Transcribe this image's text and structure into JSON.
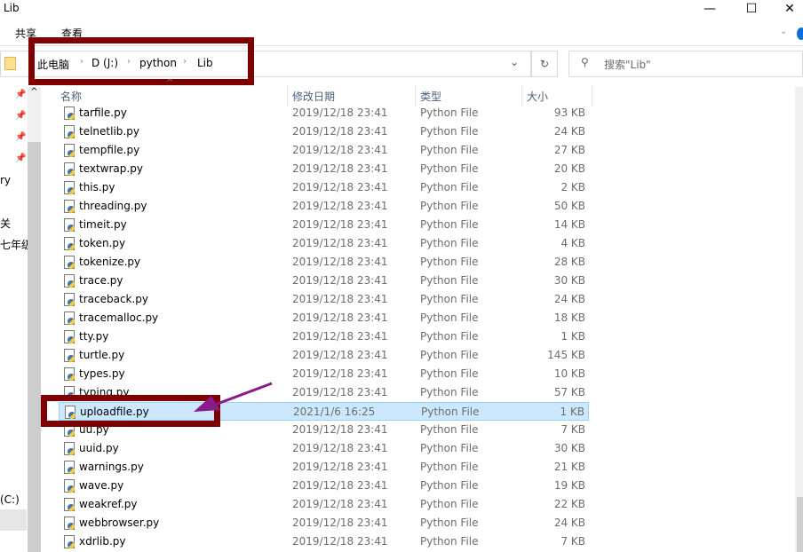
{
  "window": {
    "title": "Lib",
    "minimize": "—",
    "maximize": "☐",
    "close": "✕"
  },
  "ribbon": {
    "tabs": [
      "共享",
      "查看"
    ]
  },
  "address": {
    "crumbs": [
      "此电脑",
      "D (J:)",
      "python",
      "Lib"
    ],
    "separator": "›",
    "dropdown": "⌄",
    "refresh": "↻"
  },
  "search": {
    "placeholder": "搜索\"Lib\"",
    "icon": "search-icon"
  },
  "nav": {
    "items": [
      "ry",
      "关",
      "七年级",
      "(C:)"
    ],
    "pin": "📌"
  },
  "columns": {
    "name": "名称",
    "date": "修改日期",
    "type": "类型",
    "size": "大小"
  },
  "files": [
    {
      "name": "tarfile.py",
      "date": "2019/12/18 23:41",
      "type": "Python File",
      "size": "93 KB"
    },
    {
      "name": "telnetlib.py",
      "date": "2019/12/18 23:41",
      "type": "Python File",
      "size": "24 KB"
    },
    {
      "name": "tempfile.py",
      "date": "2019/12/18 23:41",
      "type": "Python File",
      "size": "27 KB"
    },
    {
      "name": "textwrap.py",
      "date": "2019/12/18 23:41",
      "type": "Python File",
      "size": "20 KB"
    },
    {
      "name": "this.py",
      "date": "2019/12/18 23:41",
      "type": "Python File",
      "size": "2 KB"
    },
    {
      "name": "threading.py",
      "date": "2019/12/18 23:41",
      "type": "Python File",
      "size": "50 KB"
    },
    {
      "name": "timeit.py",
      "date": "2019/12/18 23:41",
      "type": "Python File",
      "size": "14 KB"
    },
    {
      "name": "token.py",
      "date": "2019/12/18 23:41",
      "type": "Python File",
      "size": "4 KB"
    },
    {
      "name": "tokenize.py",
      "date": "2019/12/18 23:41",
      "type": "Python File",
      "size": "28 KB"
    },
    {
      "name": "trace.py",
      "date": "2019/12/18 23:41",
      "type": "Python File",
      "size": "30 KB"
    },
    {
      "name": "traceback.py",
      "date": "2019/12/18 23:41",
      "type": "Python File",
      "size": "24 KB"
    },
    {
      "name": "tracemalloc.py",
      "date": "2019/12/18 23:41",
      "type": "Python File",
      "size": "18 KB"
    },
    {
      "name": "tty.py",
      "date": "2019/12/18 23:41",
      "type": "Python File",
      "size": "1 KB"
    },
    {
      "name": "turtle.py",
      "date": "2019/12/18 23:41",
      "type": "Python File",
      "size": "145 KB"
    },
    {
      "name": "types.py",
      "date": "2019/12/18 23:41",
      "type": "Python File",
      "size": "10 KB"
    },
    {
      "name": "typing.py",
      "date": "2019/12/18 23:41",
      "type": "Python File",
      "size": "57 KB"
    },
    {
      "name": "uploadfile.py",
      "date": "2021/1/6 16:25",
      "type": "Python File",
      "size": "1 KB",
      "selected": true
    },
    {
      "name": "uu.py",
      "date": "2019/12/18 23:41",
      "type": "Python File",
      "size": "7 KB"
    },
    {
      "name": "uuid.py",
      "date": "2019/12/18 23:41",
      "type": "Python File",
      "size": "30 KB"
    },
    {
      "name": "warnings.py",
      "date": "2019/12/18 23:41",
      "type": "Python File",
      "size": "21 KB"
    },
    {
      "name": "wave.py",
      "date": "2019/12/18 23:41",
      "type": "Python File",
      "size": "19 KB"
    },
    {
      "name": "weakref.py",
      "date": "2019/12/18 23:41",
      "type": "Python File",
      "size": "22 KB"
    },
    {
      "name": "webbrowser.py",
      "date": "2019/12/18 23:41",
      "type": "Python File",
      "size": "24 KB"
    },
    {
      "name": "xdrlib.py",
      "date": "2019/12/18 23:41",
      "type": "Python File",
      "size": "7 KB"
    }
  ],
  "colors": {
    "highlight_box": "#7f0000",
    "arrow": "#8b1a8b",
    "selection": "#cce8ff"
  }
}
